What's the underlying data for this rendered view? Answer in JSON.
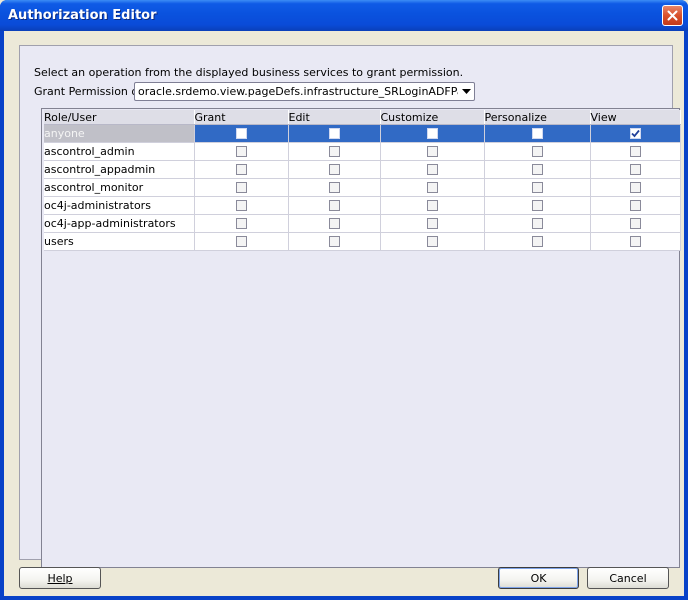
{
  "window": {
    "title": "Authorization Editor"
  },
  "dialog": {
    "instruction": "Select an operation from the displayed business services to grant permission.",
    "grant_label": "Grant Permission on:",
    "grant_value": "oracle.srdemo.view.pageDefs.infrastructure_SRLoginADFPageDef"
  },
  "table": {
    "columns": [
      "Role/User",
      "Grant",
      "Edit",
      "Customize",
      "Personalize",
      "View"
    ],
    "rows": [
      {
        "role": "anyone",
        "selected": true,
        "grant": false,
        "edit": false,
        "customize": false,
        "personalize": false,
        "view": true
      },
      {
        "role": "ascontrol_admin",
        "selected": false,
        "grant": false,
        "edit": false,
        "customize": false,
        "personalize": false,
        "view": false
      },
      {
        "role": "ascontrol_appadmin",
        "selected": false,
        "grant": false,
        "edit": false,
        "customize": false,
        "personalize": false,
        "view": false
      },
      {
        "role": "ascontrol_monitor",
        "selected": false,
        "grant": false,
        "edit": false,
        "customize": false,
        "personalize": false,
        "view": false
      },
      {
        "role": "oc4j-administrators",
        "selected": false,
        "grant": false,
        "edit": false,
        "customize": false,
        "personalize": false,
        "view": false
      },
      {
        "role": "oc4j-app-administrators",
        "selected": false,
        "grant": false,
        "edit": false,
        "customize": false,
        "personalize": false,
        "view": false
      },
      {
        "role": "users",
        "selected": false,
        "grant": false,
        "edit": false,
        "customize": false,
        "personalize": false,
        "view": false
      }
    ]
  },
  "buttons": {
    "help": "Help",
    "ok": "OK",
    "cancel": "Cancel"
  },
  "colors": {
    "titlebar": "#0a52de",
    "selection": "#316ac5",
    "close": "#d9512b"
  }
}
